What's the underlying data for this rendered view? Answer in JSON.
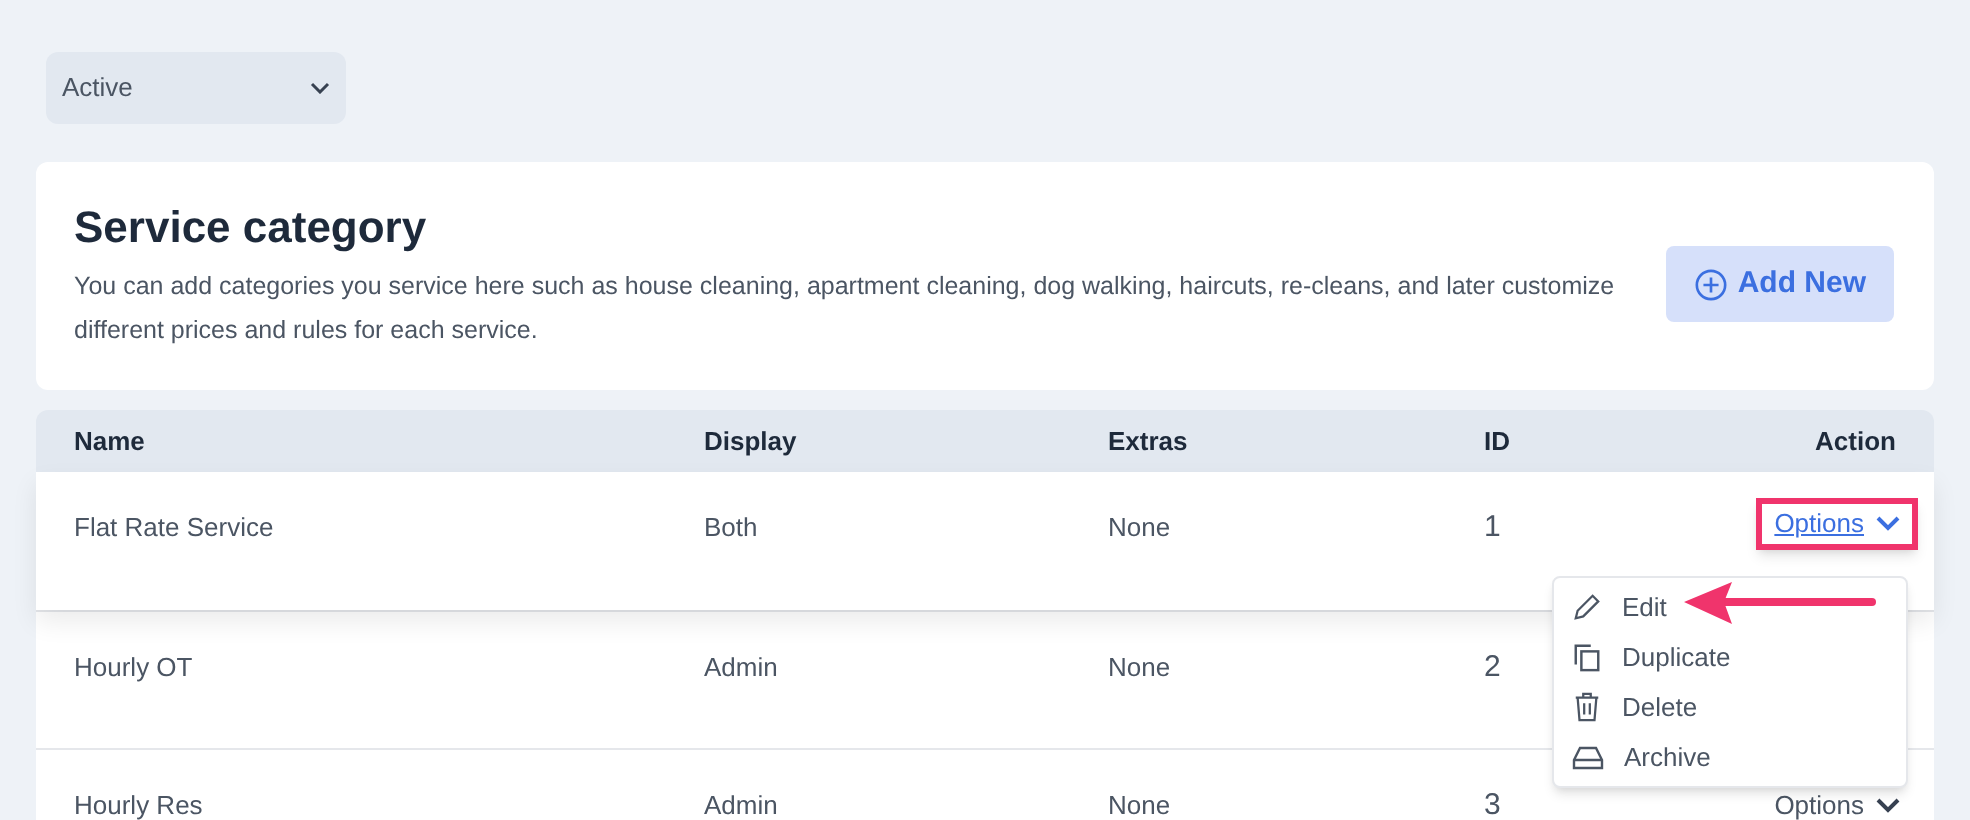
{
  "status_filter": {
    "value": "Active"
  },
  "header": {
    "title": "Service category",
    "description": "You can add categories you service here such as house cleaning, apartment cleaning, dog walking, haircuts, re-cleans, and later customize different prices and rules for each service.",
    "add_button": "Add New"
  },
  "table": {
    "columns": [
      "Name",
      "Display",
      "Extras",
      "ID",
      "Action"
    ],
    "rows": [
      {
        "name": "Flat Rate Service",
        "display": "Both",
        "extras": "None",
        "id": "1",
        "action": "Options",
        "selected": true,
        "expanded": true
      },
      {
        "name": "Hourly OT",
        "display": "Admin",
        "extras": "None",
        "id": "2",
        "selected": false
      },
      {
        "name": "Hourly Res",
        "display": "Admin",
        "extras": "None",
        "id": "3",
        "action": "Options",
        "selected": false,
        "expanded": false
      }
    ]
  },
  "options_menu": [
    {
      "kind": "edit",
      "label": "Edit"
    },
    {
      "kind": "duplicate",
      "label": "Duplicate"
    },
    {
      "kind": "delete",
      "label": "Delete"
    },
    {
      "kind": "archive",
      "label": "Archive"
    }
  ]
}
